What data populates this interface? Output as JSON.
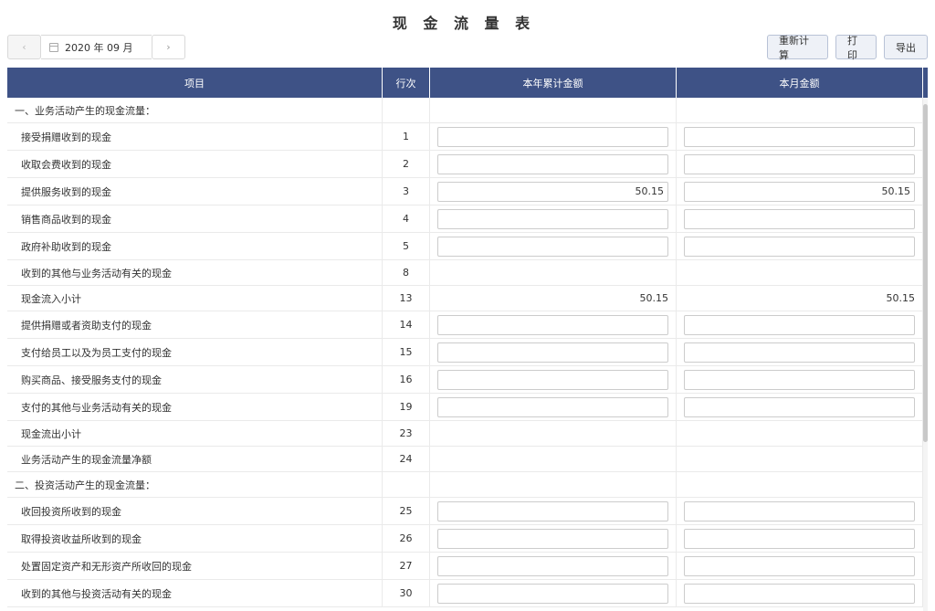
{
  "title": "现 金 流 量 表",
  "date_picker": {
    "prev": "‹",
    "next": "›",
    "value": "2020 年 09 月"
  },
  "toolbar": {
    "recalc": "重新计算",
    "print": "打印",
    "export": "导出"
  },
  "columns": [
    "项目",
    "行次",
    "本年累计金额",
    "本月金额"
  ],
  "rows": [
    {
      "label": "一、业务活动产生的现金流量：",
      "line": "",
      "type": "section",
      "year": "",
      "month": ""
    },
    {
      "label": "接受捐赠收到的现金",
      "line": "1",
      "type": "input",
      "year": "",
      "month": ""
    },
    {
      "label": "收取会费收到的现金",
      "line": "2",
      "type": "input",
      "year": "",
      "month": ""
    },
    {
      "label": "提供服务收到的现金",
      "line": "3",
      "type": "input",
      "year": "50.15",
      "month": "50.15"
    },
    {
      "label": "销售商品收到的现金",
      "line": "4",
      "type": "input",
      "year": "",
      "month": ""
    },
    {
      "label": "政府补助收到的现金",
      "line": "5",
      "type": "input",
      "year": "",
      "month": ""
    },
    {
      "label": "收到的其他与业务活动有关的现金",
      "line": "8",
      "type": "text",
      "year": "",
      "month": ""
    },
    {
      "label": "现金流入小计",
      "line": "13",
      "type": "text",
      "year": "50.15",
      "month": "50.15"
    },
    {
      "label": "提供捐赠或者资助支付的现金",
      "line": "14",
      "type": "input",
      "year": "",
      "month": ""
    },
    {
      "label": "支付给员工以及为员工支付的现金",
      "line": "15",
      "type": "input",
      "year": "",
      "month": ""
    },
    {
      "label": "购买商品、接受服务支付的现金",
      "line": "16",
      "type": "input",
      "year": "",
      "month": ""
    },
    {
      "label": "支付的其他与业务活动有关的现金",
      "line": "19",
      "type": "input",
      "year": "",
      "month": ""
    },
    {
      "label": "现金流出小计",
      "line": "23",
      "type": "text",
      "year": "",
      "month": ""
    },
    {
      "label": "业务活动产生的现金流量净额",
      "line": "24",
      "type": "text",
      "year": "",
      "month": ""
    },
    {
      "label": "二、投资活动产生的现金流量：",
      "line": "",
      "type": "section",
      "year": "",
      "month": ""
    },
    {
      "label": "收回投资所收到的现金",
      "line": "25",
      "type": "input",
      "year": "",
      "month": ""
    },
    {
      "label": "取得投资收益所收到的现金",
      "line": "26",
      "type": "input",
      "year": "",
      "month": ""
    },
    {
      "label": "处置固定资产和无形资产所收回的现金",
      "line": "27",
      "type": "input",
      "year": "",
      "month": ""
    },
    {
      "label": "收到的其他与投资活动有关的现金",
      "line": "30",
      "type": "input",
      "year": "",
      "month": ""
    }
  ]
}
